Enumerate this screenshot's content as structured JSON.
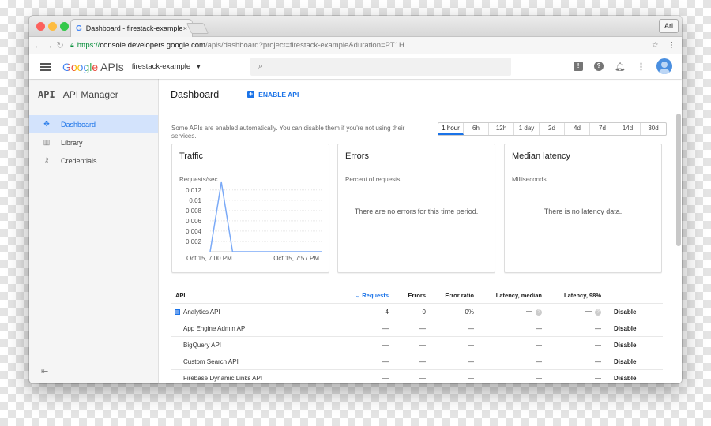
{
  "browser": {
    "tab_title": "Dashboard - firestack-example",
    "user": "Ari",
    "url_scheme": "https://",
    "url_domain": "console.developers.google.com",
    "url_path": "/apis/dashboard?project=firestack-example&duration=PT1H"
  },
  "appbar": {
    "logo_google": "Google",
    "logo_apis": "APIs",
    "project": "firestack-example"
  },
  "sidebar": {
    "title": "API Manager",
    "items": [
      {
        "label": "Dashboard",
        "icon": "dashboard-icon",
        "active": true
      },
      {
        "label": "Library",
        "icon": "library-icon",
        "active": false
      },
      {
        "label": "Credentials",
        "icon": "key-icon",
        "active": false
      }
    ]
  },
  "page": {
    "title": "Dashboard",
    "enable_label": "ENABLE API",
    "info": "Some APIs are enabled automatically. You can disable them if you're not using their services.",
    "ranges": [
      "1 hour",
      "6h",
      "12h",
      "1 day",
      "2d",
      "4d",
      "7d",
      "14d",
      "30d"
    ],
    "selected_range": "1 hour"
  },
  "cards": {
    "traffic": {
      "title": "Traffic",
      "subtitle": "Requests/sec"
    },
    "errors": {
      "title": "Errors",
      "subtitle": "Percent of requests",
      "empty": "There are no errors for this time period."
    },
    "latency": {
      "title": "Median latency",
      "subtitle": "Milliseconds",
      "empty": "There is no latency data."
    }
  },
  "chart_data": {
    "type": "line",
    "title": "Traffic",
    "ylabel": "Requests/sec",
    "x_ticks": [
      "Oct 15, 7:00 PM",
      "Oct 15, 7:57 PM"
    ],
    "y_ticks": [
      0.002,
      0.004,
      0.006,
      0.008,
      0.01,
      0.012
    ],
    "ylim": [
      0,
      0.0135
    ],
    "series": [
      {
        "values": [
          0,
          0.0135,
          0,
          0,
          0,
          0,
          0,
          0,
          0,
          0,
          0,
          0
        ]
      }
    ],
    "x_fraction": [
      0.0,
      0.1,
      0.2,
      0.3,
      0.4,
      0.5,
      0.6,
      0.7,
      0.8,
      0.9,
      0.95,
      1.0
    ],
    "line_color": "#7baaf7"
  },
  "table": {
    "headers": [
      "API",
      "Requests",
      "Errors",
      "Error ratio",
      "Latency, median",
      "Latency, 98%"
    ],
    "rows": [
      {
        "name": "Analytics API",
        "requests": "4",
        "errors": "0",
        "ratio": "0%",
        "lat_median": "—",
        "lat_98": "—",
        "action": "Disable"
      },
      {
        "name": "App Engine Admin API",
        "requests": "—",
        "errors": "—",
        "ratio": "—",
        "lat_median": "—",
        "lat_98": "—",
        "action": "Disable"
      },
      {
        "name": "BigQuery API",
        "requests": "—",
        "errors": "—",
        "ratio": "—",
        "lat_median": "—",
        "lat_98": "—",
        "action": "Disable"
      },
      {
        "name": "Custom Search API",
        "requests": "—",
        "errors": "—",
        "ratio": "—",
        "lat_median": "—",
        "lat_98": "—",
        "action": "Disable"
      },
      {
        "name": "Firebase Dynamic Links API",
        "requests": "—",
        "errors": "—",
        "ratio": "—",
        "lat_median": "—",
        "lat_98": "—",
        "action": "Disable"
      }
    ]
  }
}
